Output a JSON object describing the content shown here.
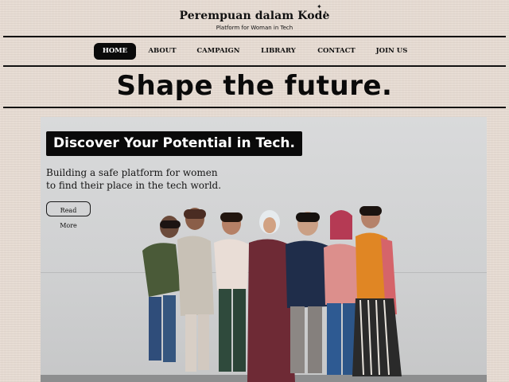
{
  "header": {
    "brand_title": "Perempuan dalam Kode",
    "brand_subtitle": "Platform for Woman in Tech"
  },
  "nav": {
    "items": [
      {
        "label": "HOME",
        "active": true
      },
      {
        "label": "ABOUT",
        "active": false
      },
      {
        "label": "CAMPAIGN",
        "active": false
      },
      {
        "label": "LIBRARY",
        "active": false
      },
      {
        "label": "CONTACT",
        "active": false
      },
      {
        "label": "JOIN US",
        "active": false
      }
    ]
  },
  "tagline": "Shape the future.",
  "hero": {
    "heading": "Discover Your Potential in Tech.",
    "text_line_1": "Building a safe platform for women",
    "text_line_2": "to find their place in the tech world.",
    "button_label": "Read More"
  },
  "colors": {
    "page_background": "#e6dbd2",
    "accent_dark": "#0a0a0a",
    "active_nav_text": "#ffffff"
  },
  "icons": {
    "brand_sparkle": "sparkle-icon"
  }
}
